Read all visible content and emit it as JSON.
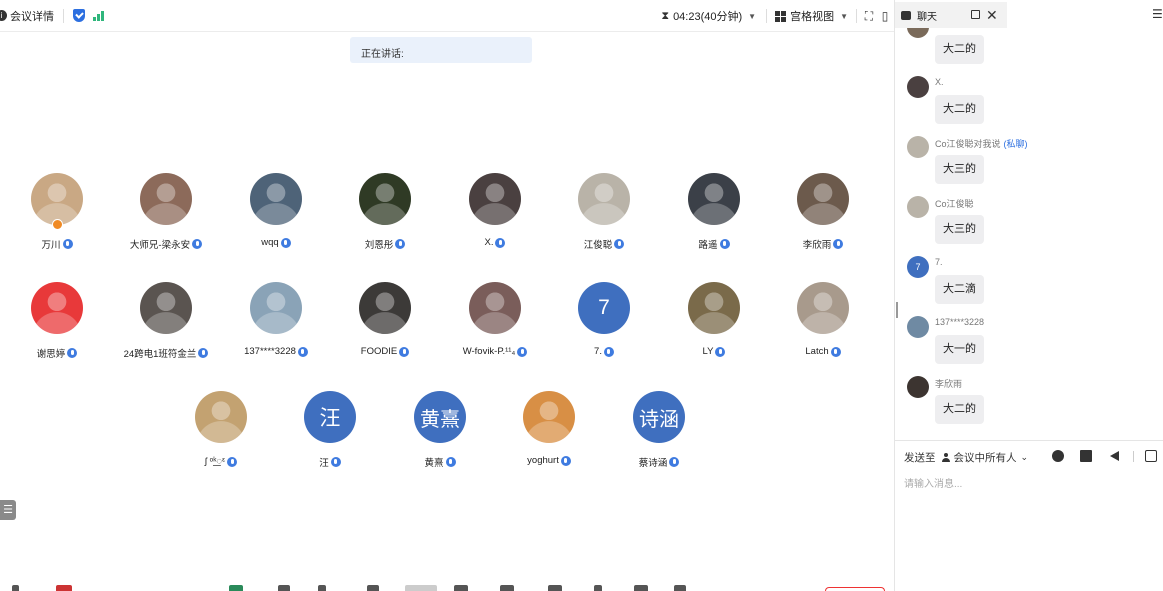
{
  "topbar": {
    "meeting_details": "会议详情",
    "timer": "04:23(40分钟)",
    "view_mode": "宫格视图"
  },
  "speaking_label": "正在讲话:",
  "participants": [
    {
      "name": "万川",
      "color": "#c9a884",
      "host": true
    },
    {
      "name": "大师兄-梁永安",
      "color": "#8c6a5a"
    },
    {
      "name": "wqq",
      "color": "#4e6378"
    },
    {
      "name": "刘恩彤",
      "color": "#2f3a25"
    },
    {
      "name": "X.",
      "color": "#4a4040"
    },
    {
      "name": "江俊聪",
      "color": "#b9b3a8"
    },
    {
      "name": "路遥",
      "color": "#3b4048"
    },
    {
      "name": "李欣雨",
      "color": "#6c5a4c"
    },
    {
      "name": "谢思婷",
      "color": "#e8393a"
    },
    {
      "name": "24跨电1班符金兰",
      "color": "#5a5450"
    },
    {
      "name": "137****3228",
      "color": "#8aa3b7"
    },
    {
      "name": "FOODIE",
      "color": "#3c3a38"
    },
    {
      "name": "W-fovik-P.¹¹₄",
      "color": "#7a5d5a"
    },
    {
      "name": "7.",
      "initial": "7",
      "color": "#3f6fbf"
    },
    {
      "name": "LY",
      "color": "#7a6a4a"
    },
    {
      "name": "Latch",
      "color": "#a89a8c"
    },
    {
      "name": "ʃ ᵒᵏ꯭ᵋ",
      "color": "#c3a271"
    },
    {
      "name": "汪",
      "initial": "汪",
      "color": "#3f6fbf"
    },
    {
      "name": "黄熹",
      "initial": "黄熹",
      "color": "#3f6fbf"
    },
    {
      "name": "yoghurt",
      "color": "#d88f45"
    },
    {
      "name": "蔡诗涵",
      "initial": "诗涵",
      "color": "#3f6fbf"
    }
  ],
  "chat": {
    "tab_label": "聊天",
    "messages": [
      {
        "sender": "",
        "text": "大二的",
        "color": "#7a6a5a"
      },
      {
        "sender": "X.",
        "text": "大二的",
        "color": "#4a4040"
      },
      {
        "sender": "Co江俊聪对我说",
        "private": "(私聊)",
        "text": "大三的",
        "color": "#b9b3a8"
      },
      {
        "sender": "Co江俊聪",
        "text": "大三的",
        "color": "#b9b3a8"
      },
      {
        "sender": "7.",
        "initial": "7",
        "text": "大二滴",
        "color": "#3f6fbf"
      },
      {
        "sender": "137****3228",
        "text": "大一的",
        "color": "#6f8aa3"
      },
      {
        "sender": "李欣雨",
        "text": "大二的",
        "color": "#3c3430"
      }
    ],
    "send_to_label": "发送至",
    "recipient": "会议中所有人",
    "input_placeholder": "请输入消息..."
  }
}
